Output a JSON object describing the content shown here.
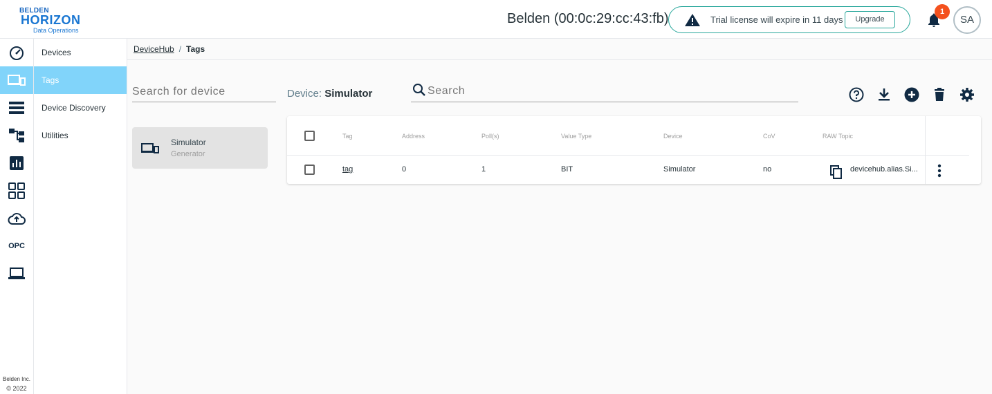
{
  "logo": {
    "line1": "BELDEN",
    "line2": "HORIZON",
    "line3": "Data Operations"
  },
  "header": {
    "device_id": "Belden (00:0c:29:cc:43:fb)",
    "license_text": "Trial license will expire in 11 days",
    "upgrade_label": "Upgrade",
    "notification_count": "1",
    "avatar_initials": "SA"
  },
  "rail": {
    "icons": [
      "dashboard-icon",
      "devices-icon",
      "list-icon",
      "hierarchy-icon",
      "chart-icon",
      "apps-grid-icon",
      "cloud-upload-icon",
      "opc-icon",
      "laptop-icon"
    ],
    "opc_label": "OPC",
    "copyright_company": "Belden Inc.",
    "copyright_year": "© 2022"
  },
  "nav": {
    "items": [
      {
        "label": "Devices"
      },
      {
        "label": "Tags",
        "active": true
      },
      {
        "label": "Device Discovery"
      },
      {
        "label": "Utilities"
      }
    ]
  },
  "breadcrumb": {
    "parent": "DeviceHub",
    "separator": "/",
    "current": "Tags"
  },
  "device_search": {
    "placeholder": "Search for device"
  },
  "device_list": [
    {
      "name": "Simulator",
      "type": "Generator"
    }
  ],
  "selected_device": {
    "prefix": "Device:",
    "name": "Simulator"
  },
  "tag_search": {
    "placeholder": "Search"
  },
  "toolbar": [
    "help-icon",
    "download-icon",
    "add-icon",
    "delete-icon",
    "settings-icon"
  ],
  "table": {
    "columns": [
      "Tag",
      "Address",
      "Poll(s)",
      "Value Type",
      "Device",
      "CoV",
      "RAW Topic"
    ],
    "rows": [
      {
        "tag": "tag",
        "address": "0",
        "poll": "1",
        "value_type": "BIT",
        "device": "Simulator",
        "cov": "no",
        "raw_topic": "devicehub.alias.Si..."
      }
    ]
  },
  "colors": {
    "accent": "#81d4fa",
    "license_border": "#26a69a",
    "badge": "#f4511e",
    "icon": "#102a43"
  }
}
